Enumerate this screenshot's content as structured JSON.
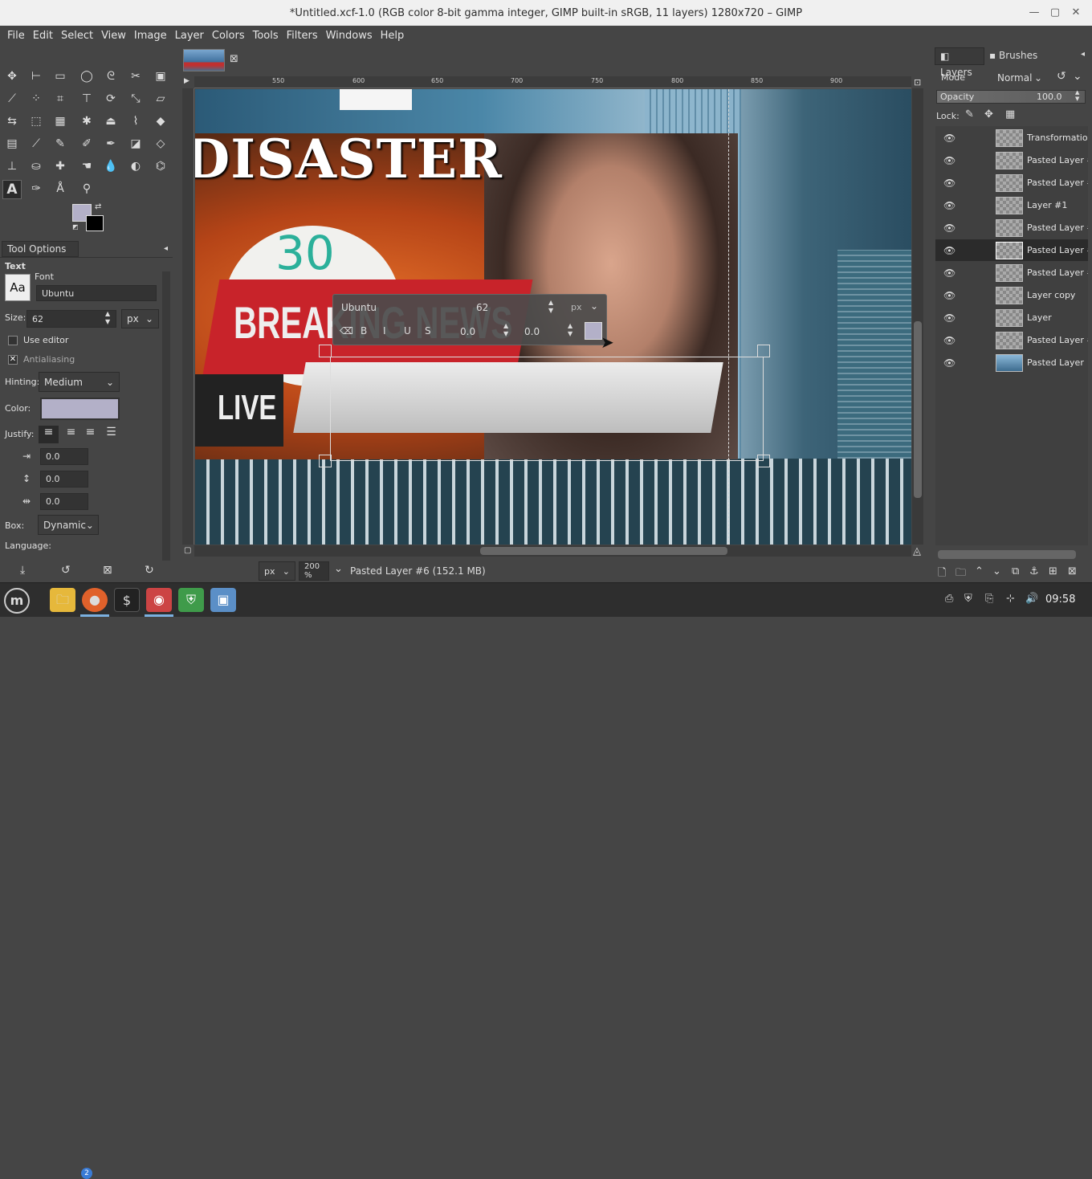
{
  "window": {
    "title": "*Untitled.xcf-1.0 (RGB color 8-bit gamma integer, GIMP built-in sRGB, 11 layers) 1280x720 – GIMP",
    "minimize": "—",
    "maximize": "▢",
    "close": "✕"
  },
  "menu": [
    "File",
    "Edit",
    "Select",
    "View",
    "Image",
    "Layer",
    "Colors",
    "Tools",
    "Filters",
    "Windows",
    "Help"
  ],
  "colors": {
    "fg": "#b3b0c8",
    "bg": "#000000",
    "accent": "#c8232a"
  },
  "tool_options": {
    "tab_label": "Tool Options",
    "section": "Text",
    "font_label": "Font",
    "font_preview": "Aa",
    "font_value": "Ubuntu",
    "size_label": "Size:",
    "size_value": "62",
    "size_unit": "px",
    "use_editor": "Use editor",
    "antialiasing": "Antialiasing",
    "hinting_label": "Hinting:",
    "hinting_value": "Medium",
    "color_label": "Color:",
    "justify_label": "Justify:",
    "indent_value": "0.0",
    "line_spacing_value": "0.0",
    "letter_spacing_value": "0.0",
    "box_label": "Box:",
    "box_value": "Dynamic",
    "language_label": "Language:"
  },
  "ruler": {
    "marks": [
      "550",
      "600",
      "650",
      "700",
      "750",
      "800",
      "850",
      "900"
    ]
  },
  "image_text": {
    "disaster": "DISASTER",
    "breaking": "BREAKING NEWS",
    "live": "LIVE",
    "clock": "30"
  },
  "floating_text": {
    "font": "Ubuntu",
    "size": "62",
    "unit": "px",
    "baseline": "0.0",
    "kerning": "0.0"
  },
  "status": {
    "unit": "px",
    "zoom": "200 %",
    "message": "Pasted Layer #6 (152.1 MB)"
  },
  "dock": {
    "tabs": [
      "Layers",
      "Brushes"
    ],
    "mode_label": "Mode",
    "mode_value": "Normal",
    "opacity_label": "Opacity",
    "opacity_value": "100.0",
    "lock_label": "Lock:",
    "layers": [
      "Transformation",
      "Pasted Layer #",
      "Pasted Layer #",
      "Layer #1",
      "Pasted Layer #",
      "Pasted Layer #",
      "Pasted Layer #",
      "Layer copy",
      "Layer",
      "Pasted Layer #",
      "Pasted Layer"
    ],
    "selected_index": 5
  },
  "taskbar": {
    "badge": "2",
    "time": "09:58"
  }
}
